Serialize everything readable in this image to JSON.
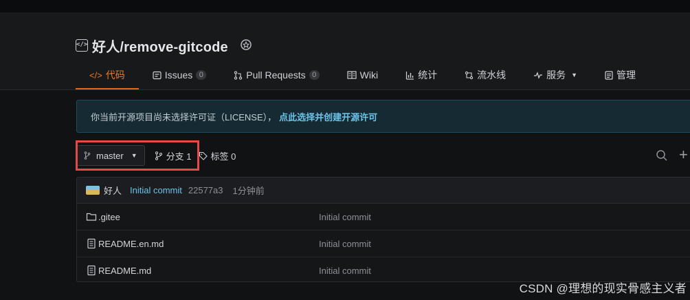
{
  "repo": {
    "owner_name": "好人/remove-gitcode"
  },
  "tabs": [
    {
      "label": "代码",
      "icon": "code-icon",
      "count": null
    },
    {
      "label": "Issues",
      "icon": "issues-icon",
      "count": "0"
    },
    {
      "label": "Pull Requests",
      "icon": "pull-request-icon",
      "count": "0"
    },
    {
      "label": "Wiki",
      "icon": "wiki-icon",
      "count": null
    },
    {
      "label": "统计",
      "icon": "stats-icon",
      "count": null
    },
    {
      "label": "流水线",
      "icon": "pipeline-icon",
      "count": null
    },
    {
      "label": "服务",
      "icon": "service-icon",
      "count": null
    },
    {
      "label": "管理",
      "icon": "manage-icon",
      "count": null
    }
  ],
  "notice": {
    "text": "你当前开源项目尚未选择许可证（LICENSE），",
    "link": "点此选择并创建开源许可"
  },
  "branchbar": {
    "branch": "master",
    "branches_label": "分支 1",
    "tags_label": "标签 0"
  },
  "commit": {
    "author": "好人",
    "message": "Initial commit",
    "sha": "22577a3",
    "time": "1分钟前"
  },
  "files": [
    {
      "name": ".gitee",
      "type": "folder",
      "commit": "Initial commit"
    },
    {
      "name": "README.en.md",
      "type": "file",
      "commit": "Initial commit"
    },
    {
      "name": "README.md",
      "type": "file",
      "commit": "Initial commit"
    }
  ],
  "watermark": "CSDN @理想的现实骨感主义者",
  "colors": {
    "accent": "#e8641b",
    "link": "#6cc3e8",
    "highlight_box": "#e14b4b",
    "background": "#111214"
  }
}
